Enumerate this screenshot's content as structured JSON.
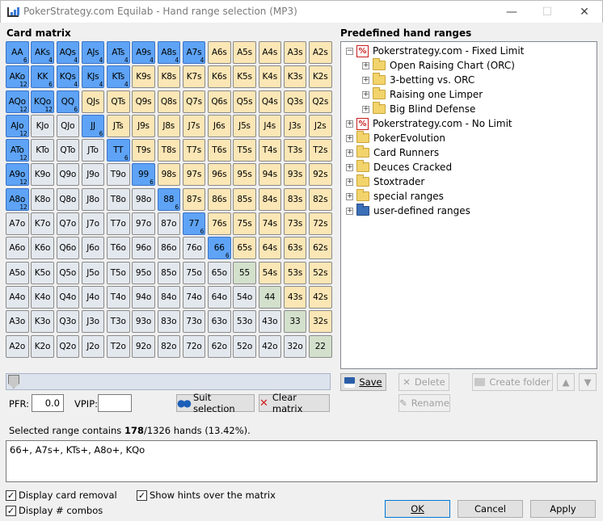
{
  "window": {
    "title": "PokerStrategy.com Equilab - Hand range selection (MP3)",
    "controls": [
      "—",
      "☐",
      "✕"
    ]
  },
  "card_matrix": {
    "heading": "Card matrix",
    "rows": [
      [
        {
          "l": "AA",
          "t": "pair",
          "s": true,
          "n": "6"
        },
        {
          "l": "AKs",
          "t": "suited",
          "s": true,
          "n": "4"
        },
        {
          "l": "AQs",
          "t": "suited",
          "s": true,
          "n": "4"
        },
        {
          "l": "AJs",
          "t": "suited",
          "s": true,
          "n": "4"
        },
        {
          "l": "ATs",
          "t": "suited",
          "s": true,
          "n": "4"
        },
        {
          "l": "A9s",
          "t": "suited",
          "s": true,
          "n": "4"
        },
        {
          "l": "A8s",
          "t": "suited",
          "s": true,
          "n": "4"
        },
        {
          "l": "A7s",
          "t": "suited",
          "s": true,
          "n": "4"
        },
        {
          "l": "A6s",
          "t": "suited"
        },
        {
          "l": "A5s",
          "t": "suited"
        },
        {
          "l": "A4s",
          "t": "suited"
        },
        {
          "l": "A3s",
          "t": "suited"
        },
        {
          "l": "A2s",
          "t": "suited"
        }
      ],
      [
        {
          "l": "AKo",
          "t": "offsuit",
          "s": true,
          "n": "12"
        },
        {
          "l": "KK",
          "t": "pair",
          "s": true,
          "n": "6"
        },
        {
          "l": "KQs",
          "t": "suited",
          "s": true,
          "n": "4"
        },
        {
          "l": "KJs",
          "t": "suited",
          "s": true,
          "n": "4"
        },
        {
          "l": "KTs",
          "t": "suited",
          "s": true,
          "n": "4"
        },
        {
          "l": "K9s",
          "t": "suited"
        },
        {
          "l": "K8s",
          "t": "suited"
        },
        {
          "l": "K7s",
          "t": "suited"
        },
        {
          "l": "K6s",
          "t": "suited"
        },
        {
          "l": "K5s",
          "t": "suited"
        },
        {
          "l": "K4s",
          "t": "suited"
        },
        {
          "l": "K3s",
          "t": "suited"
        },
        {
          "l": "K2s",
          "t": "suited"
        }
      ],
      [
        {
          "l": "AQo",
          "t": "offsuit",
          "s": true,
          "n": "12"
        },
        {
          "l": "KQo",
          "t": "offsuit",
          "s": true,
          "n": "12"
        },
        {
          "l": "QQ",
          "t": "pair",
          "s": true,
          "n": "6"
        },
        {
          "l": "QJs",
          "t": "suited"
        },
        {
          "l": "QTs",
          "t": "suited"
        },
        {
          "l": "Q9s",
          "t": "suited"
        },
        {
          "l": "Q8s",
          "t": "suited"
        },
        {
          "l": "Q7s",
          "t": "suited"
        },
        {
          "l": "Q6s",
          "t": "suited"
        },
        {
          "l": "Q5s",
          "t": "suited"
        },
        {
          "l": "Q4s",
          "t": "suited"
        },
        {
          "l": "Q3s",
          "t": "suited"
        },
        {
          "l": "Q2s",
          "t": "suited"
        }
      ],
      [
        {
          "l": "AJo",
          "t": "offsuit",
          "s": true,
          "n": "12"
        },
        {
          "l": "KJo",
          "t": "offsuit"
        },
        {
          "l": "QJo",
          "t": "offsuit"
        },
        {
          "l": "JJ",
          "t": "pair",
          "s": true,
          "n": "6"
        },
        {
          "l": "JTs",
          "t": "suited"
        },
        {
          "l": "J9s",
          "t": "suited"
        },
        {
          "l": "J8s",
          "t": "suited"
        },
        {
          "l": "J7s",
          "t": "suited"
        },
        {
          "l": "J6s",
          "t": "suited"
        },
        {
          "l": "J5s",
          "t": "suited"
        },
        {
          "l": "J4s",
          "t": "suited"
        },
        {
          "l": "J3s",
          "t": "suited"
        },
        {
          "l": "J2s",
          "t": "suited"
        }
      ],
      [
        {
          "l": "ATo",
          "t": "offsuit",
          "s": true,
          "n": "12"
        },
        {
          "l": "KTo",
          "t": "offsuit"
        },
        {
          "l": "QTo",
          "t": "offsuit"
        },
        {
          "l": "JTo",
          "t": "offsuit"
        },
        {
          "l": "TT",
          "t": "pair",
          "s": true,
          "n": "6"
        },
        {
          "l": "T9s",
          "t": "suited"
        },
        {
          "l": "T8s",
          "t": "suited"
        },
        {
          "l": "T7s",
          "t": "suited"
        },
        {
          "l": "T6s",
          "t": "suited"
        },
        {
          "l": "T5s",
          "t": "suited"
        },
        {
          "l": "T4s",
          "t": "suited"
        },
        {
          "l": "T3s",
          "t": "suited"
        },
        {
          "l": "T2s",
          "t": "suited"
        }
      ],
      [
        {
          "l": "A9o",
          "t": "offsuit",
          "s": true,
          "n": "12"
        },
        {
          "l": "K9o",
          "t": "offsuit"
        },
        {
          "l": "Q9o",
          "t": "offsuit"
        },
        {
          "l": "J9o",
          "t": "offsuit"
        },
        {
          "l": "T9o",
          "t": "offsuit"
        },
        {
          "l": "99",
          "t": "pair",
          "s": true,
          "n": "6"
        },
        {
          "l": "98s",
          "t": "suited"
        },
        {
          "l": "97s",
          "t": "suited"
        },
        {
          "l": "96s",
          "t": "suited"
        },
        {
          "l": "95s",
          "t": "suited"
        },
        {
          "l": "94s",
          "t": "suited"
        },
        {
          "l": "93s",
          "t": "suited"
        },
        {
          "l": "92s",
          "t": "suited"
        }
      ],
      [
        {
          "l": "A8o",
          "t": "offsuit",
          "s": true,
          "n": "12"
        },
        {
          "l": "K8o",
          "t": "offsuit"
        },
        {
          "l": "Q8o",
          "t": "offsuit"
        },
        {
          "l": "J8o",
          "t": "offsuit"
        },
        {
          "l": "T8o",
          "t": "offsuit"
        },
        {
          "l": "98o",
          "t": "offsuit"
        },
        {
          "l": "88",
          "t": "pair",
          "s": true,
          "n": "6"
        },
        {
          "l": "87s",
          "t": "suited"
        },
        {
          "l": "86s",
          "t": "suited"
        },
        {
          "l": "85s",
          "t": "suited"
        },
        {
          "l": "84s",
          "t": "suited"
        },
        {
          "l": "83s",
          "t": "suited"
        },
        {
          "l": "82s",
          "t": "suited"
        }
      ],
      [
        {
          "l": "A7o",
          "t": "offsuit"
        },
        {
          "l": "K7o",
          "t": "offsuit"
        },
        {
          "l": "Q7o",
          "t": "offsuit"
        },
        {
          "l": "J7o",
          "t": "offsuit"
        },
        {
          "l": "T7o",
          "t": "offsuit"
        },
        {
          "l": "97o",
          "t": "offsuit"
        },
        {
          "l": "87o",
          "t": "offsuit"
        },
        {
          "l": "77",
          "t": "pair",
          "s": true,
          "n": "6"
        },
        {
          "l": "76s",
          "t": "suited"
        },
        {
          "l": "75s",
          "t": "suited"
        },
        {
          "l": "74s",
          "t": "suited"
        },
        {
          "l": "73s",
          "t": "suited"
        },
        {
          "l": "72s",
          "t": "suited"
        }
      ],
      [
        {
          "l": "A6o",
          "t": "offsuit"
        },
        {
          "l": "K6o",
          "t": "offsuit"
        },
        {
          "l": "Q6o",
          "t": "offsuit"
        },
        {
          "l": "J6o",
          "t": "offsuit"
        },
        {
          "l": "T6o",
          "t": "offsuit"
        },
        {
          "l": "96o",
          "t": "offsuit"
        },
        {
          "l": "86o",
          "t": "offsuit"
        },
        {
          "l": "76o",
          "t": "offsuit"
        },
        {
          "l": "66",
          "t": "pair",
          "s": true,
          "n": "6"
        },
        {
          "l": "65s",
          "t": "suited"
        },
        {
          "l": "64s",
          "t": "suited"
        },
        {
          "l": "63s",
          "t": "suited"
        },
        {
          "l": "62s",
          "t": "suited"
        }
      ],
      [
        {
          "l": "A5o",
          "t": "offsuit"
        },
        {
          "l": "K5o",
          "t": "offsuit"
        },
        {
          "l": "Q5o",
          "t": "offsuit"
        },
        {
          "l": "J5o",
          "t": "offsuit"
        },
        {
          "l": "T5o",
          "t": "offsuit"
        },
        {
          "l": "95o",
          "t": "offsuit"
        },
        {
          "l": "85o",
          "t": "offsuit"
        },
        {
          "l": "75o",
          "t": "offsuit"
        },
        {
          "l": "65o",
          "t": "offsuit"
        },
        {
          "l": "55",
          "t": "pp"
        },
        {
          "l": "54s",
          "t": "suited"
        },
        {
          "l": "53s",
          "t": "suited"
        },
        {
          "l": "52s",
          "t": "suited"
        }
      ],
      [
        {
          "l": "A4o",
          "t": "offsuit"
        },
        {
          "l": "K4o",
          "t": "offsuit"
        },
        {
          "l": "Q4o",
          "t": "offsuit"
        },
        {
          "l": "J4o",
          "t": "offsuit"
        },
        {
          "l": "T4o",
          "t": "offsuit"
        },
        {
          "l": "94o",
          "t": "offsuit"
        },
        {
          "l": "84o",
          "t": "offsuit"
        },
        {
          "l": "74o",
          "t": "offsuit"
        },
        {
          "l": "64o",
          "t": "offsuit"
        },
        {
          "l": "54o",
          "t": "offsuit"
        },
        {
          "l": "44",
          "t": "pp"
        },
        {
          "l": "43s",
          "t": "suited"
        },
        {
          "l": "42s",
          "t": "suited"
        }
      ],
      [
        {
          "l": "A3o",
          "t": "offsuit"
        },
        {
          "l": "K3o",
          "t": "offsuit"
        },
        {
          "l": "Q3o",
          "t": "offsuit"
        },
        {
          "l": "J3o",
          "t": "offsuit"
        },
        {
          "l": "T3o",
          "t": "offsuit"
        },
        {
          "l": "93o",
          "t": "offsuit"
        },
        {
          "l": "83o",
          "t": "offsuit"
        },
        {
          "l": "73o",
          "t": "offsuit"
        },
        {
          "l": "63o",
          "t": "offsuit"
        },
        {
          "l": "53o",
          "t": "offsuit"
        },
        {
          "l": "43o",
          "t": "offsuit"
        },
        {
          "l": "33",
          "t": "pp"
        },
        {
          "l": "32s",
          "t": "suited"
        }
      ],
      [
        {
          "l": "A2o",
          "t": "offsuit"
        },
        {
          "l": "K2o",
          "t": "offsuit"
        },
        {
          "l": "Q2o",
          "t": "offsuit"
        },
        {
          "l": "J2o",
          "t": "offsuit"
        },
        {
          "l": "T2o",
          "t": "offsuit"
        },
        {
          "l": "92o",
          "t": "offsuit"
        },
        {
          "l": "82o",
          "t": "offsuit"
        },
        {
          "l": "72o",
          "t": "offsuit"
        },
        {
          "l": "62o",
          "t": "offsuit"
        },
        {
          "l": "52o",
          "t": "offsuit"
        },
        {
          "l": "42o",
          "t": "offsuit"
        },
        {
          "l": "32o",
          "t": "offsuit"
        },
        {
          "l": "22",
          "t": "pp"
        }
      ]
    ],
    "slider_value": 0
  },
  "controls": {
    "pfr_label": "PFR:",
    "pfr_value": "0.0",
    "vpip_label": "VPIP:",
    "vpip_value": "",
    "suit_selection": "Suit selection",
    "clear_matrix": "Clear matrix"
  },
  "predefined": {
    "heading": "Predefined hand ranges",
    "tree": [
      {
        "label": "Pokerstrategy.com - Fixed Limit",
        "icon": "ps-logo-icon",
        "expanded": true,
        "level": 0,
        "children": [
          "Open Raising Chart (ORC)",
          "3-betting vs. ORC",
          "Raising one Limper",
          "Big Blind Defense"
        ]
      },
      {
        "label": "Pokerstrategy.com - No Limit",
        "icon": "ps-logo-icon",
        "level": 0
      },
      {
        "label": "PokerEvolution",
        "icon": "folder-icon",
        "level": 0
      },
      {
        "label": "Card Runners",
        "icon": "folder-icon",
        "level": 0
      },
      {
        "label": "Deuces Cracked",
        "icon": "folder-icon",
        "level": 0
      },
      {
        "label": "Stoxtrader",
        "icon": "folder-icon",
        "level": 0
      },
      {
        "label": "special ranges",
        "icon": "folder-icon",
        "level": 0
      },
      {
        "label": "user-defined ranges",
        "icon": "user-folder-icon",
        "level": 0
      }
    ],
    "buttons": {
      "save": "Save",
      "delete": "Delete",
      "create_folder": "Create folder",
      "rename": "Rename"
    }
  },
  "summary": {
    "prefix": "Selected range contains ",
    "count": "178",
    "suffix": "/1326 hands (13.42%).",
    "range_text": "66+, A7s+, KTs+, A8o+, KQo"
  },
  "options": {
    "display_card_removal": "Display card removal",
    "display_combos": "Display # combos",
    "show_hints": "Show hints over the matrix"
  },
  "footer": {
    "ok": "OK",
    "cancel": "Cancel",
    "apply": "Apply"
  },
  "colors": {
    "selected": "#5ea3f5",
    "suited": "#fbe6b5",
    "offsuit": "#e3e8ee",
    "pocket_pair": "#d3e0cc"
  }
}
